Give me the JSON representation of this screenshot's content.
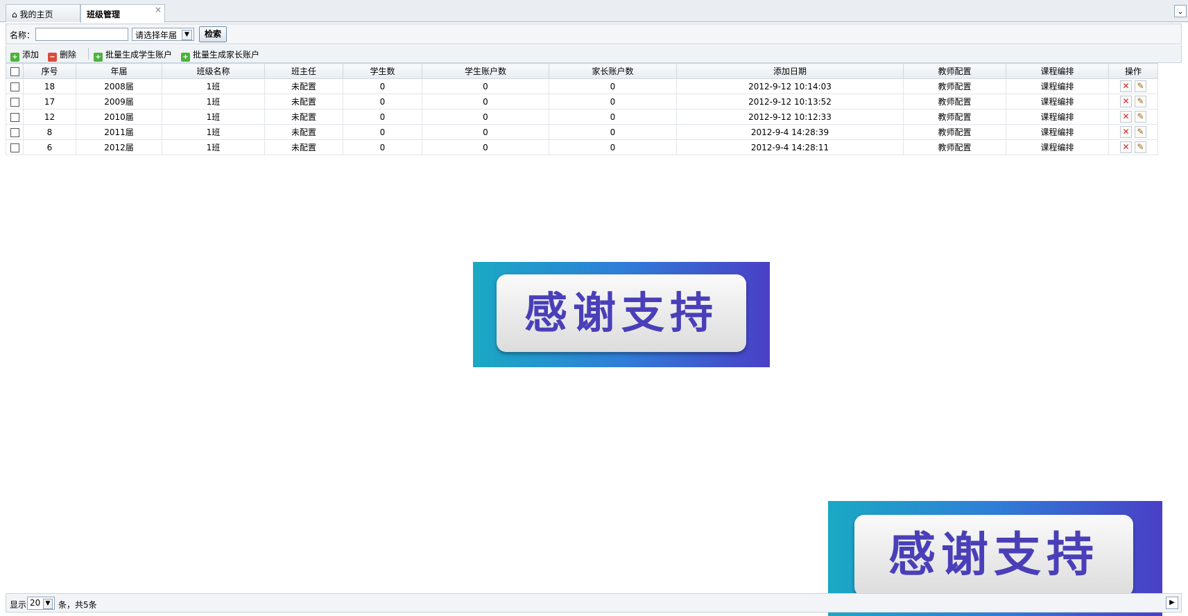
{
  "tabs": [
    {
      "label": "我的主页",
      "icon": "home-icon"
    },
    {
      "label": "班级管理",
      "close": "×"
    }
  ],
  "search": {
    "name_label": "名称：",
    "name_value": "",
    "year_select": "请选择年届",
    "search_button": "检索"
  },
  "toolbar": {
    "add": "添加",
    "delete": "删除",
    "gen_student": "批量生成学生账户",
    "gen_parent": "批量生成家长账户"
  },
  "grid": {
    "headers": [
      "序号",
      "年届",
      "班级名称",
      "班主任",
      "学生数",
      "学生账户数",
      "家长账户数",
      "添加日期",
      "教师配置",
      "课程编排",
      "操作"
    ],
    "rows": [
      [
        "18",
        "2008届",
        "1班",
        "未配置",
        "0",
        "0",
        "0",
        "2012-9-12 10:14:03",
        "教师配置",
        "课程编排"
      ],
      [
        "17",
        "2009届",
        "1班",
        "未配置",
        "0",
        "0",
        "0",
        "2012-9-12 10:13:52",
        "教师配置",
        "课程编排"
      ],
      [
        "12",
        "2010届",
        "1班",
        "未配置",
        "0",
        "0",
        "0",
        "2012-9-12 10:12:33",
        "教师配置",
        "课程编排"
      ],
      [
        "8",
        "2011届",
        "1班",
        "未配置",
        "0",
        "0",
        "0",
        "2012-9-4 14:28:39",
        "教师配置",
        "课程编排"
      ],
      [
        "6",
        "2012届",
        "1班",
        "未配置",
        "0",
        "0",
        "0",
        "2012-9-4 14:28:11",
        "教师配置",
        "课程编排"
      ]
    ]
  },
  "banner_text": "感谢支持",
  "pager": {
    "show_label": "显示",
    "page_size": "20",
    "total_text": "条，共5条"
  },
  "colors": {
    "accent": "#4a3fb8",
    "delete_red": "#d22222",
    "add_green": "#4bb33b"
  }
}
